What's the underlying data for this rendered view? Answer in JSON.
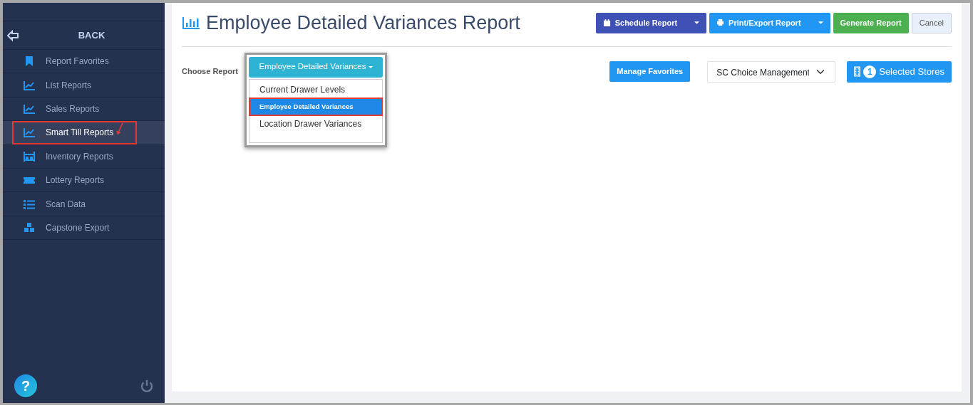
{
  "sidebar": {
    "back_label": "BACK",
    "items": [
      {
        "label": "Report Favorites",
        "selected": false,
        "annotated": false
      },
      {
        "label": "List Reports",
        "selected": false,
        "annotated": false
      },
      {
        "label": "Sales Reports",
        "selected": false,
        "annotated": false
      },
      {
        "label": "Smart Till Reports",
        "selected": true,
        "annotated": true
      },
      {
        "label": "Inventory Reports",
        "selected": false,
        "annotated": false
      },
      {
        "label": "Lottery Reports",
        "selected": false,
        "annotated": false
      },
      {
        "label": "Scan Data",
        "selected": false,
        "annotated": false
      },
      {
        "label": "Capstone Export",
        "selected": false,
        "annotated": false
      }
    ],
    "help": "?"
  },
  "page": {
    "title": "Employee Detailed Variances Report",
    "buttons": [
      {
        "label": "Schedule Report",
        "kind": "split",
        "color": "#3f51b5"
      },
      {
        "label": "Print/Export Report",
        "kind": "split",
        "color": "#2196f3"
      },
      {
        "label": "Generate Report",
        "kind": "plain",
        "color": "#4caf50"
      },
      {
        "label": "Cancel",
        "kind": "light",
        "color": "#e8f1fb"
      }
    ],
    "choose_label": "Choose Report",
    "report_dropdown": {
      "value": "Employee Detailed Variances",
      "expanded": true,
      "options": [
        {
          "label": "Current Drawer Levels",
          "selected": false,
          "annotated": false
        },
        {
          "label": "Employee Detailed Variances",
          "selected": true,
          "annotated": true
        },
        {
          "label": "Location Drawer Variances",
          "selected": false,
          "annotated": false
        }
      ]
    },
    "manage_favorites": "Manage Favorites",
    "company_select": "SC Choice Management",
    "stores_count": "1",
    "stores_label": "Selected Stores"
  }
}
